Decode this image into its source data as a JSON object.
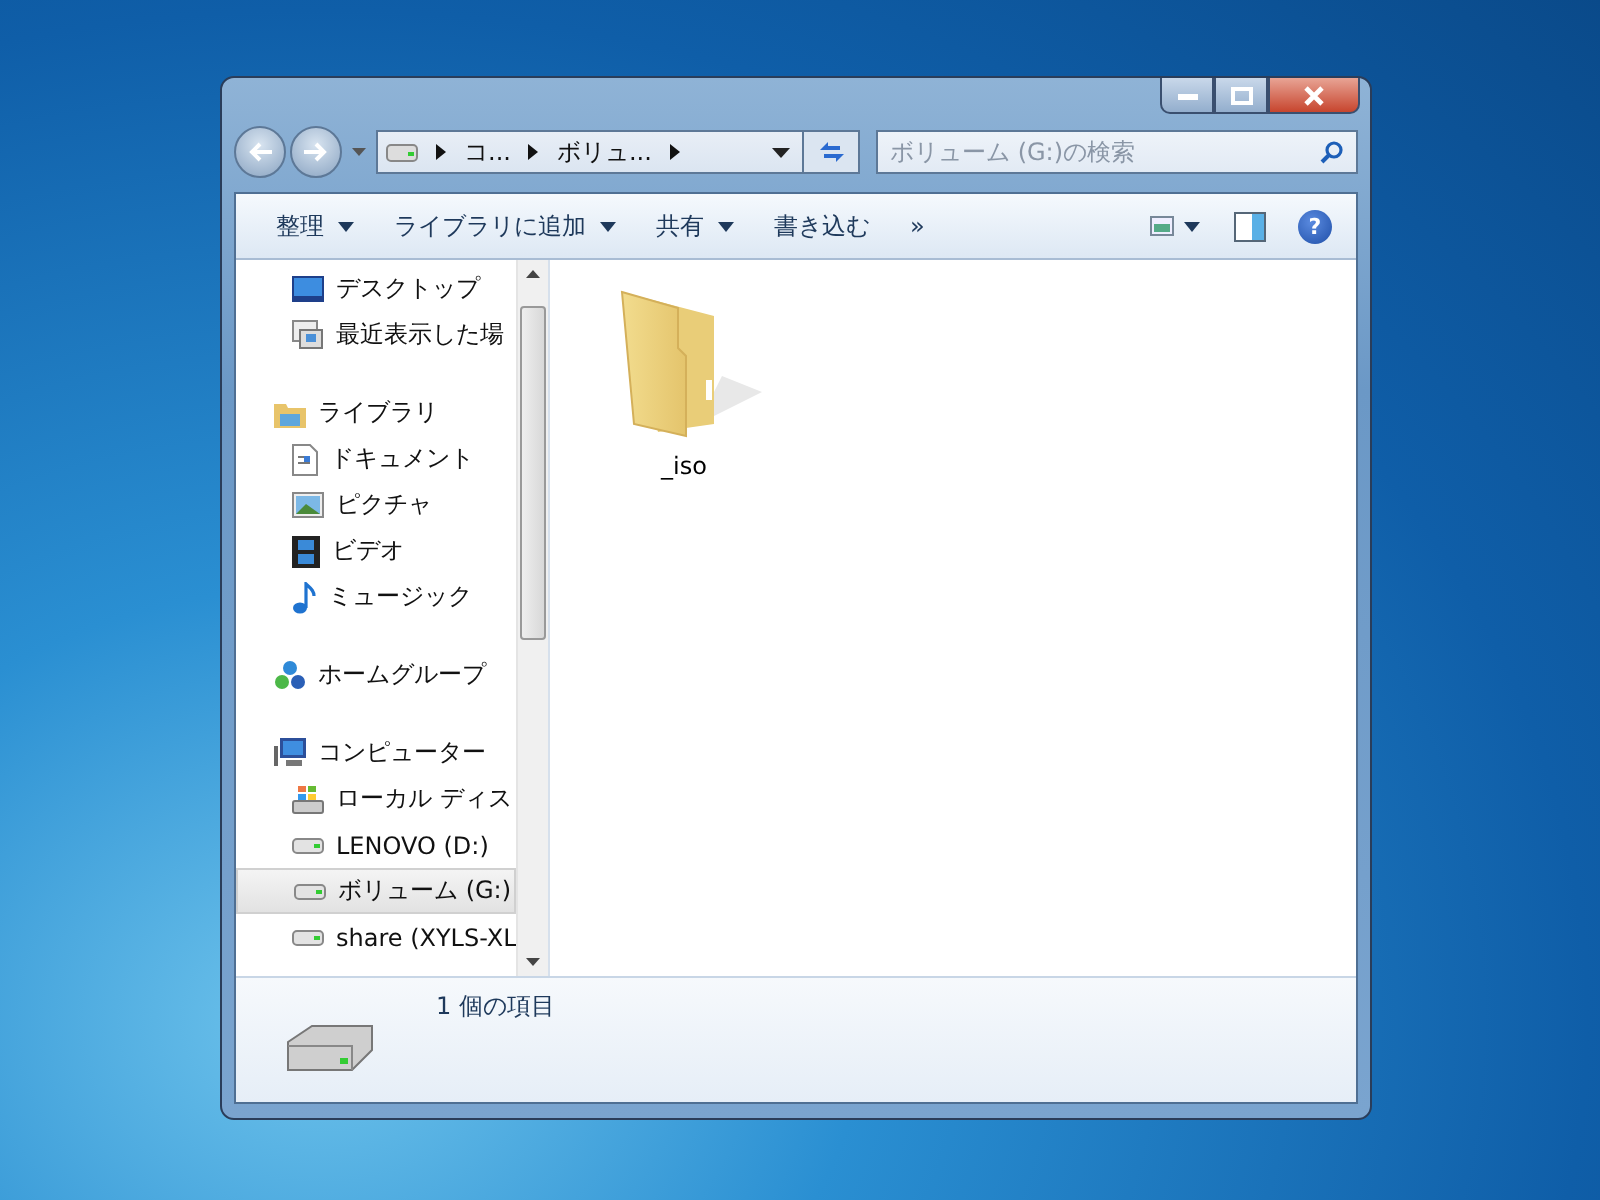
{
  "address_bar": {
    "segments": [
      "コ...",
      "ボリュ..."
    ]
  },
  "search": {
    "placeholder": "ボリューム (G:)の検索"
  },
  "toolbar": {
    "items": [
      {
        "label": "整理",
        "dropdown": true
      },
      {
        "label": "ライブラリに追加",
        "dropdown": true
      },
      {
        "label": "共有",
        "dropdown": true
      },
      {
        "label": "書き込む",
        "dropdown": false
      },
      {
        "label": "»",
        "dropdown": false
      }
    ]
  },
  "help_button": {
    "label": "?"
  },
  "navigation": {
    "groups": [
      {
        "children": [
          {
            "label": "デスクトップ",
            "kind": "desktop",
            "selected": false
          },
          {
            "label": "最近表示した場",
            "kind": "recent",
            "selected": false
          }
        ]
      },
      {
        "label": "ライブラリ",
        "kind": "library",
        "selected": false,
        "children": [
          {
            "label": "ドキュメント",
            "kind": "document",
            "selected": false
          },
          {
            "label": "ピクチャ",
            "kind": "picture",
            "selected": false
          },
          {
            "label": "ビデオ",
            "kind": "video",
            "selected": false
          },
          {
            "label": "ミュージック",
            "kind": "music",
            "selected": false
          }
        ]
      },
      {
        "label": "ホームグループ",
        "kind": "homegroup",
        "selected": false
      },
      {
        "label": "コンピューター",
        "kind": "computer",
        "selected": false,
        "children": [
          {
            "label": "ローカル ディス",
            "kind": "system-drive",
            "selected": false
          },
          {
            "label": "LENOVO (D:)",
            "kind": "drive",
            "selected": false
          },
          {
            "label": "ボリューム (G:)",
            "kind": "drive",
            "selected": true
          },
          {
            "label": "share (XYLS-XL",
            "kind": "drive",
            "selected": false
          }
        ]
      }
    ]
  },
  "files": [
    {
      "name": "_iso"
    }
  ],
  "status_bar": {
    "text": "1 個の項目"
  }
}
